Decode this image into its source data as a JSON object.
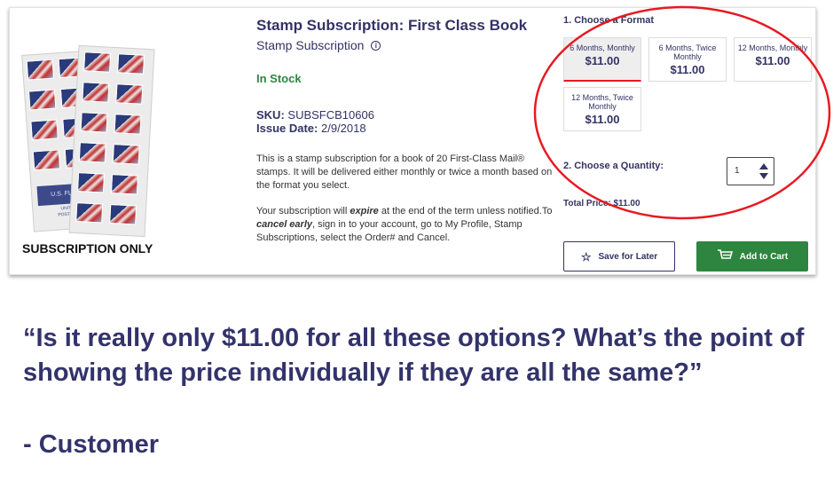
{
  "product": {
    "title": "Stamp Subscription: First Class Book",
    "subtitle": "Stamp Subscription",
    "image_caption": "SUBSCRIPTION ONLY",
    "image_label": "U.S. FLAG",
    "stock_status": "In Stock",
    "sku_label": "SKU:",
    "sku_value": "SUBSFCB10606",
    "issue_label": "Issue Date:",
    "issue_value": "2/9/2018",
    "description": "This is a stamp subscription for a book of 20 First-Class Mail® stamps. It will be delivered either monthly or twice a month based on the format you select.",
    "expire_part1": "Your subscription will ",
    "expire_word": "expire",
    "expire_part2": " at the end of the term unless notified.To ",
    "cancel_word": "cancel early",
    "expire_part3": ", sign in to your account, go to My Profile, Stamp Subscriptions, select the Order# and Cancel."
  },
  "format": {
    "heading": "1. Choose a Format",
    "options": [
      {
        "name": "6 Months, Monthly",
        "price": "$11.00",
        "selected": true
      },
      {
        "name": "6 Months, Twice Monthly",
        "price": "$11.00",
        "selected": false
      },
      {
        "name": "12 Months, Monthly",
        "price": "$11.00",
        "selected": false
      },
      {
        "name": "12 Months, Twice Monthly",
        "price": "$11.00",
        "selected": false
      }
    ]
  },
  "quantity": {
    "heading": "2. Choose a Quantity:",
    "value": "1"
  },
  "total": {
    "label": "Total Price:",
    "value": "$11.00"
  },
  "buttons": {
    "save_label": "Save for Later",
    "add_label": "Add to Cart"
  },
  "quote": {
    "text": "“Is it really only $11.00 for all these options? What’s the point of showing the price individually if they are all the same?”",
    "attribution": "- Customer"
  },
  "colors": {
    "brand_navy": "#333366",
    "in_stock_green": "#2e8540",
    "add_to_cart_green": "#2e8540",
    "annotation_red": "#e71921"
  },
  "icons": {
    "info": "info-icon",
    "save": "star-icon",
    "cart": "cart-icon",
    "stepper": "up-down-arrows-icon"
  }
}
